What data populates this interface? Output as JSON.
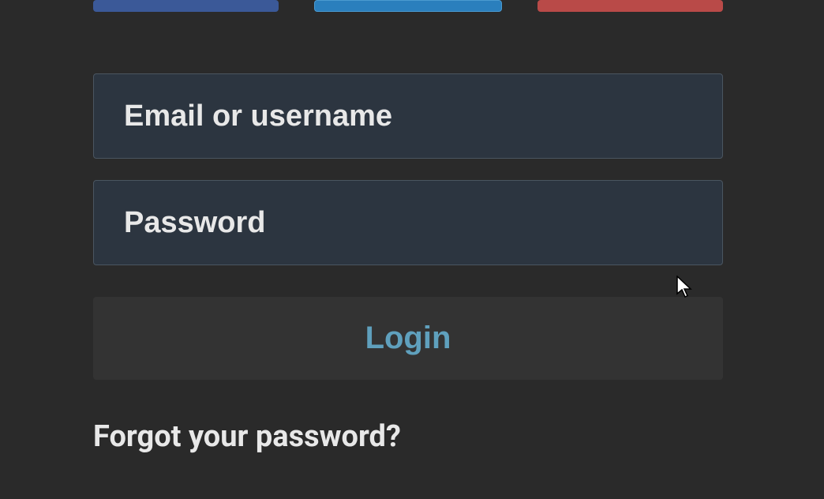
{
  "form": {
    "email_placeholder": "Email or username",
    "password_placeholder": "Password",
    "login_label": "Login",
    "forgot_label": "Forgot your password?"
  },
  "social": {
    "facebook": "#3b5998",
    "twitter": "#2a7fbd",
    "google": "#b94a48"
  }
}
